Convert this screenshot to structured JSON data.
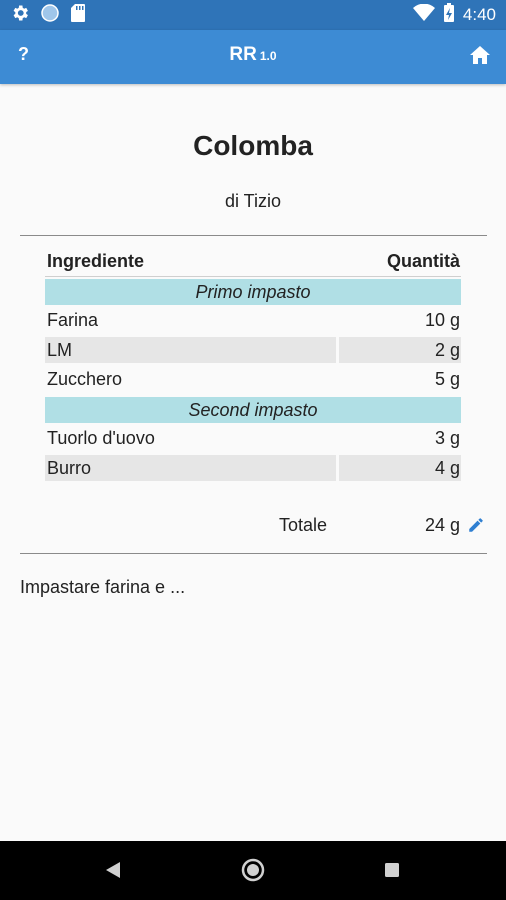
{
  "status_bar": {
    "time": "4:40",
    "icons": [
      "gear-icon",
      "circle-icon",
      "sd-card-icon",
      "wifi-icon",
      "battery-charging-icon"
    ]
  },
  "app_bar": {
    "help_label": "?",
    "title": "RR",
    "version": "1.0",
    "home_icon": "home-icon"
  },
  "recipe": {
    "title": "Colomba",
    "author": "di Tizio"
  },
  "table": {
    "header": {
      "name": "Ingrediente",
      "qty": "Quantità"
    },
    "sections": [
      {
        "title": "Primo impasto",
        "items": [
          {
            "name": "Farina",
            "qty": "10 g"
          },
          {
            "name": "LM",
            "qty": "2 g"
          },
          {
            "name": "Zucchero",
            "qty": "5 g"
          }
        ]
      },
      {
        "title": "Second impasto",
        "items": [
          {
            "name": "Tuorlo d'uovo",
            "qty": "3 g"
          },
          {
            "name": "Burro",
            "qty": "4 g"
          }
        ]
      }
    ]
  },
  "total": {
    "label": "Totale",
    "value": "24 g",
    "edit_icon": "pencil-icon"
  },
  "notes": "Impastare farina e ...",
  "nav_bar": {
    "icons": [
      "back-icon",
      "home-circle-icon",
      "recents-icon"
    ]
  },
  "colors": {
    "status_bar": "#2f74b8",
    "app_bar": "#3d8bd4",
    "section_bg": "#b0dfe5",
    "alt_row": "#e6e6e6",
    "edit_icon": "#2f7fd1"
  }
}
